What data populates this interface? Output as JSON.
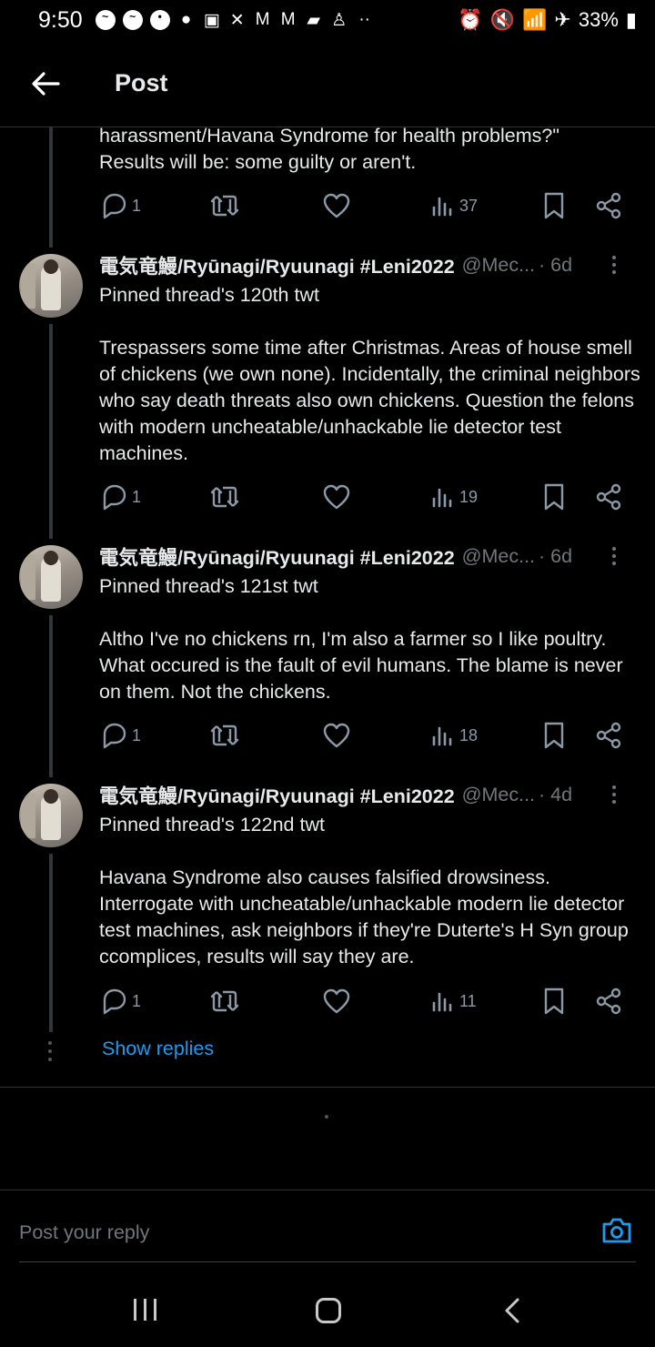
{
  "status_bar": {
    "time": "9:50",
    "battery": "33%",
    "left_icons": [
      "messenger-icon",
      "messenger-icon",
      "account-icon",
      "reddit-icon",
      "twitch-icon",
      "x-icon",
      "gmail-icon",
      "gmail-icon",
      "chat-icon",
      "person-icon",
      "more-dots-icon"
    ],
    "right_icons": [
      "alarm-icon",
      "mute-icon",
      "wifi-icon",
      "airplane-icon",
      "battery-icon"
    ]
  },
  "header": {
    "title": "Post",
    "back_icon": "arrow-left-icon"
  },
  "top_fragment": {
    "text": "harassment/Havana Syndrome for health problems?\"\nResults will be: some guilty or aren't.",
    "replies": "1",
    "views": "37"
  },
  "tweets": [
    {
      "name": "電気竜鰻/Ryūnagi/Ryuunagi #Leni2022",
      "handle": "@Mec...",
      "time": "· 6d",
      "text": "Pinned thread's 120th twt\n\nTrespassers some time after Christmas. Areas of house smell of chickens (we own none). Incidentally, the criminal neighbors who say death threats also own chickens. Question the felons with modern uncheatable/unhackable lie detector test machines.",
      "replies": "1",
      "views": "19"
    },
    {
      "name": "電気竜鰻/Ryūnagi/Ryuunagi #Leni2022",
      "handle": "@Mec...",
      "time": "· 6d",
      "text": "Pinned thread's 121st twt\n\nAltho I've no chickens rn, I'm also a farmer so I like poultry. What occured is the fault of evil humans. The blame is never on them. Not the chickens.",
      "replies": "1",
      "views": "18"
    },
    {
      "name": "電気竜鰻/Ryūnagi/Ryuunagi #Leni2022",
      "handle": "@Mec...",
      "time": "· 4d",
      "text": "Pinned thread's 122nd twt\n\nHavana Syndrome also causes falsified drowsiness. Interrogate with uncheatable/unhackable modern lie detector test machines, ask neighbors if they're Duterte's H Syn group ccomplices, results will say they are.",
      "replies": "1",
      "views": "11"
    }
  ],
  "show_replies": "Show replies",
  "reply_bar": {
    "placeholder": "Post your reply",
    "camera_icon": "camera-icon"
  },
  "colors": {
    "background": "#000000",
    "text": "#e7e9ea",
    "muted": "#71767b",
    "accent": "#1d9bf0"
  }
}
